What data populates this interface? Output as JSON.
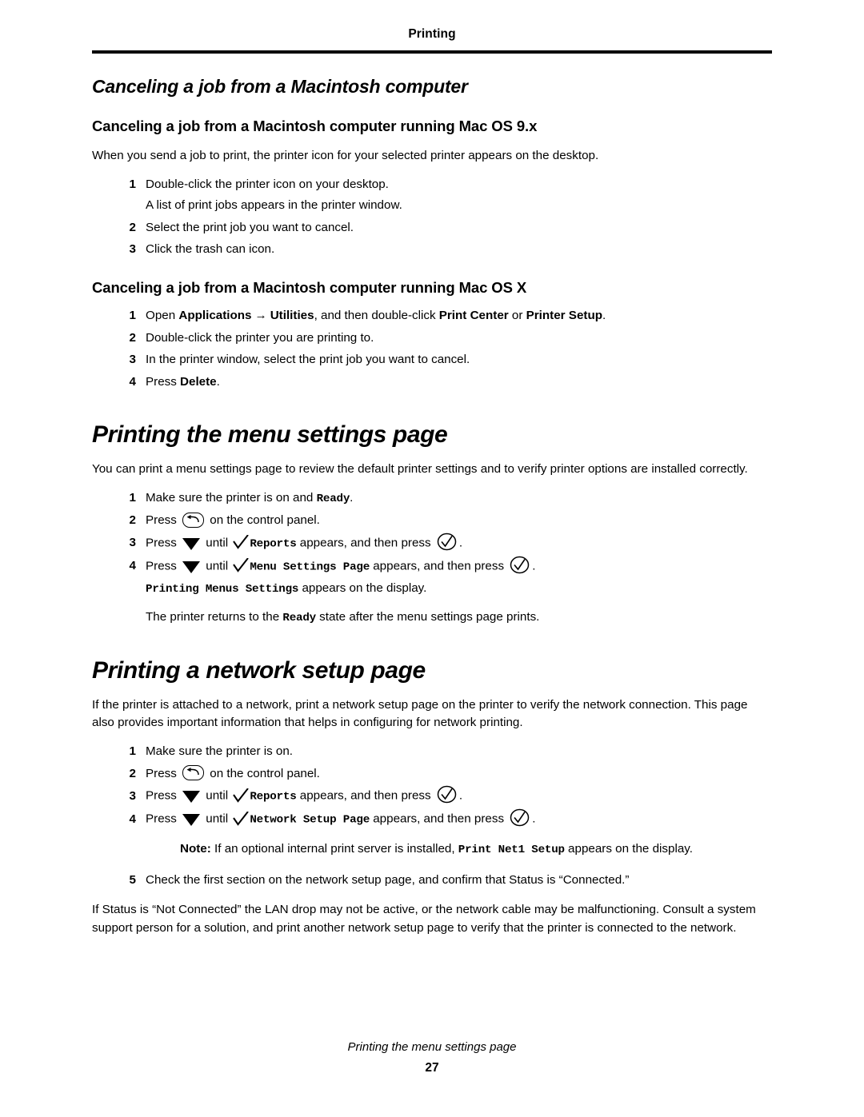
{
  "header": {
    "title": "Printing"
  },
  "sections": [
    {
      "heading": "Canceling a job from a Macintosh computer",
      "sub1": {
        "heading": "Canceling a job from a Macintosh computer running Mac OS 9.x",
        "intro": "When you send a job to print, the printer icon for your selected printer appears on the desktop.",
        "steps": [
          {
            "num": "1",
            "text": "Double-click the printer icon on your desktop."
          },
          {
            "num": "2",
            "text": "Select the print job you want to cancel."
          },
          {
            "num": "3",
            "text": "Click the trash can icon."
          }
        ],
        "step1_note": "A list of print jobs appears in the printer window."
      },
      "sub2": {
        "heading": "Canceling a job from a Macintosh computer running Mac OS X",
        "steps": [
          {
            "num": "1",
            "a": "Open ",
            "b1": "Applications",
            "arrow": "→",
            "b2": "Utilities",
            "c": ", and then double-click ",
            "b3": "Print Center",
            "d": " or ",
            "b4": "Printer Setup",
            "e": "."
          },
          {
            "num": "2",
            "text": "Double-click the printer you are printing to."
          },
          {
            "num": "3",
            "text": "In the printer window, select the print job you want to cancel."
          },
          {
            "num": "4",
            "a": "Press ",
            "b": "Delete",
            "c": "."
          }
        ]
      }
    },
    {
      "heading": "Printing the menu settings page",
      "intro": "You can print a menu settings page to review the default printer settings and to verify printer options are installed correctly.",
      "steps": {
        "s1_num": "1",
        "s1_a": "Make sure the printer is on and ",
        "s1_mono": "Ready",
        "s1_b": ".",
        "s2_num": "2",
        "s2_a": "Press ",
        "s2_b": " on the control panel.",
        "s3_num": "3",
        "s3_a": "Press ",
        "s3_b": " until ",
        "s3_mono": "Reports",
        "s3_c": " appears, and then press ",
        "s3_d": ".",
        "s4_num": "4",
        "s4_a": "Press ",
        "s4_b": " until ",
        "s4_mono": "Menu Settings Page",
        "s4_c": " appears, and then press ",
        "s4_d": "."
      },
      "after1_mono": "Printing Menus Settings",
      "after1_text": " appears on the display.",
      "after2_a": "The printer returns to the ",
      "after2_mono": "Ready",
      "after2_b": " state after the menu settings page prints."
    },
    {
      "heading": "Printing a network setup page",
      "intro": "If the printer is attached to a network, print a network setup page on the printer to verify the network connection. This page also provides important information that helps in configuring for network printing.",
      "steps": {
        "s1_num": "1",
        "s1_text": "Make sure the printer is on.",
        "s2_num": "2",
        "s2_a": "Press ",
        "s2_b": " on the control panel.",
        "s3_num": "3",
        "s3_a": "Press ",
        "s3_b": " until ",
        "s3_mono": "Reports",
        "s3_c": " appears, and then press ",
        "s3_d": ".",
        "s4_num": "4",
        "s4_a": "Press ",
        "s4_b": " until ",
        "s4_mono": "Network Setup Page",
        "s4_c": " appears, and then press ",
        "s4_d": ".",
        "s5_num": "5",
        "s5_text": "Check the first section on the network setup page, and confirm that Status is “Connected.”"
      },
      "note": {
        "label": "Note:",
        "a": " If an optional internal print server is installed, ",
        "mono": "Print Net1 Setup",
        "b": " appears on the display."
      },
      "outro": "If Status is “Not Connected” the LAN drop may not be active, or the network cable may be malfunctioning. Consult a system support person for a solution, and print another network setup page to verify that the printer is connected to the network."
    }
  ],
  "footer": {
    "title": "Printing the menu settings page",
    "page_number": "27"
  }
}
